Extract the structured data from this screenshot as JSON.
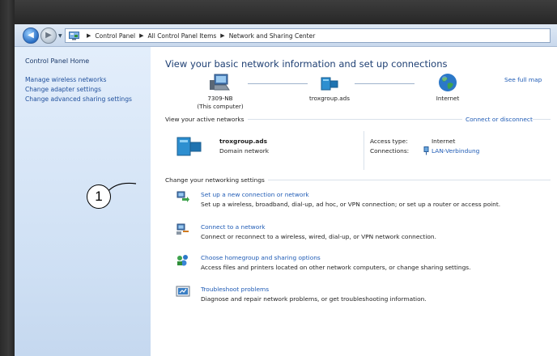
{
  "window": {
    "breadcrumb": [
      "Control Panel",
      "All Control Panel Items",
      "Network and Sharing Center"
    ]
  },
  "sidebar": {
    "home": "Control Panel Home",
    "links": [
      "Manage wireless networks",
      "Change adapter settings",
      "Change advanced sharing settings"
    ]
  },
  "main": {
    "heading": "View your basic network information and set up connections",
    "see_full_map": "See full map",
    "network_map": {
      "computer_name": "7309-NB",
      "computer_sub": "(This computer)",
      "network_name": "troxgroup.ads",
      "internet": "Internet"
    },
    "active": {
      "title": "View your active networks",
      "connect_link": "Connect or disconnect",
      "network_name": "troxgroup.ads",
      "network_type": "Domain network",
      "access_type_label": "Access type:",
      "access_type_value": "Internet",
      "connections_label": "Connections:",
      "connections_value": "LAN-Verbindung"
    },
    "settings": {
      "title": "Change your networking settings",
      "tasks": [
        {
          "title": "Set up a new connection or network",
          "desc": "Set up a wireless, broadband, dial-up, ad hoc, or VPN connection; or set up a router or access point.",
          "icon": "new-connection-icon"
        },
        {
          "title": "Connect to a network",
          "desc": "Connect or reconnect to a wireless, wired, dial-up, or VPN network connection.",
          "icon": "connect-network-icon"
        },
        {
          "title": "Choose homegroup and sharing options",
          "desc": "Access files and printers located on other network computers, or change sharing settings.",
          "icon": "homegroup-icon"
        },
        {
          "title": "Troubleshoot problems",
          "desc": "Diagnose and repair network problems, or get troubleshooting information.",
          "icon": "troubleshoot-icon"
        }
      ]
    }
  },
  "callout": {
    "number": "1"
  },
  "colors": {
    "link": "#1f5bb5",
    "heading": "#1e3f73",
    "sidebar": "#dce9f8"
  }
}
